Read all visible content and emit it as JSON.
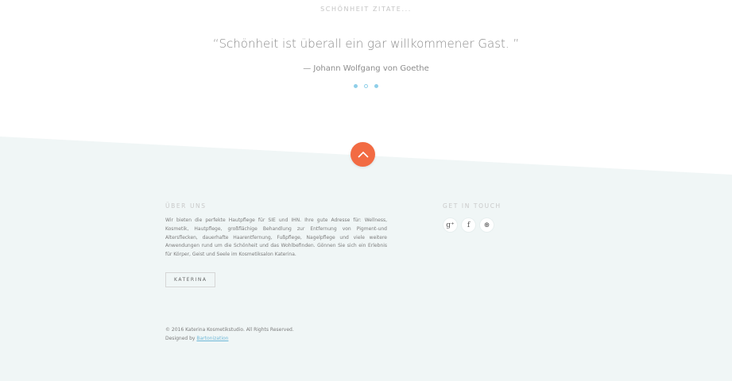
{
  "quote_section": {
    "heading": "SCHÖNHEIT ZITATE...",
    "quote": "“Schönheit ist überall ein gar willkommener Gast. ”",
    "author": "— Johann Wolfgang von Goethe",
    "dots_count": 3,
    "active_dot_index": 0
  },
  "footer": {
    "background_color": "#f0f6f6",
    "scroll_button_color": "#f26b43",
    "about": {
      "heading": "ÜBER UNS",
      "text": "Wir bieten die perfekte Hautpflege für SIE und IHN. Ihre gute Adresse für: Wellness, Kosmetik, Hautpflege, großflächige Behandlung zur Entfernung von Pigment-und Altersflecken, dauerhafte Haarentfernung, Fußpflege, Nagelpflege und viele weitere Anwendungen rund um die Schönheit und das Wohlbefinden. Gönnen Sie sich ein Erlebnis für Körper, Geist und Seele im Kosmetiksalon Katerina.",
      "button_label": "KATERINA"
    },
    "contact": {
      "heading": "GET IN TOUCH",
      "socials": [
        {
          "icon": "google-plus-icon",
          "glyph": "g⁺"
        },
        {
          "icon": "facebook-icon",
          "glyph": "f"
        },
        {
          "icon": "dribbble-icon",
          "glyph": "⊛"
        }
      ]
    },
    "copyright": "© 2016 Katerina Kosmetikstudio. All Rights Reserved.",
    "designed_by_prefix": "Designed by ",
    "designed_by_link": "Bartonization"
  }
}
